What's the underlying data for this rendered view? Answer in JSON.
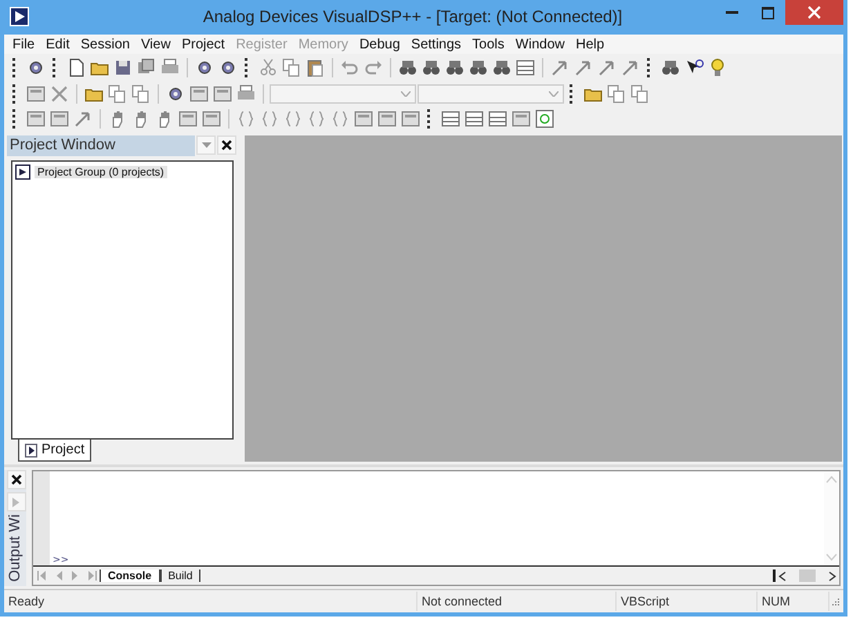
{
  "window": {
    "title": "Analog Devices VisualDSP++ - [Target: (Not Connected)]"
  },
  "menu": [
    {
      "label": "File",
      "disabled": false
    },
    {
      "label": "Edit",
      "disabled": false
    },
    {
      "label": "Session",
      "disabled": false
    },
    {
      "label": "View",
      "disabled": false
    },
    {
      "label": "Project",
      "disabled": false
    },
    {
      "label": "Register",
      "disabled": true
    },
    {
      "label": "Memory",
      "disabled": true
    },
    {
      "label": "Debug",
      "disabled": false
    },
    {
      "label": "Settings",
      "disabled": false
    },
    {
      "label": "Tools",
      "disabled": false
    },
    {
      "label": "Window",
      "disabled": false
    },
    {
      "label": "Help",
      "disabled": false
    }
  ],
  "project_window": {
    "title": "Project Window",
    "tree": [
      {
        "label": "Project Group (0 projects)",
        "selected": true
      }
    ],
    "tabs": [
      {
        "label": "Project",
        "selected": true
      }
    ]
  },
  "output_window": {
    "title": "Output Wi",
    "prompt": ">>",
    "tabs": [
      {
        "label": "Console",
        "selected": true
      },
      {
        "label": "Build",
        "selected": false
      }
    ]
  },
  "status_bar": [
    "Ready",
    "Not connected",
    "VBScript",
    "NUM"
  ]
}
